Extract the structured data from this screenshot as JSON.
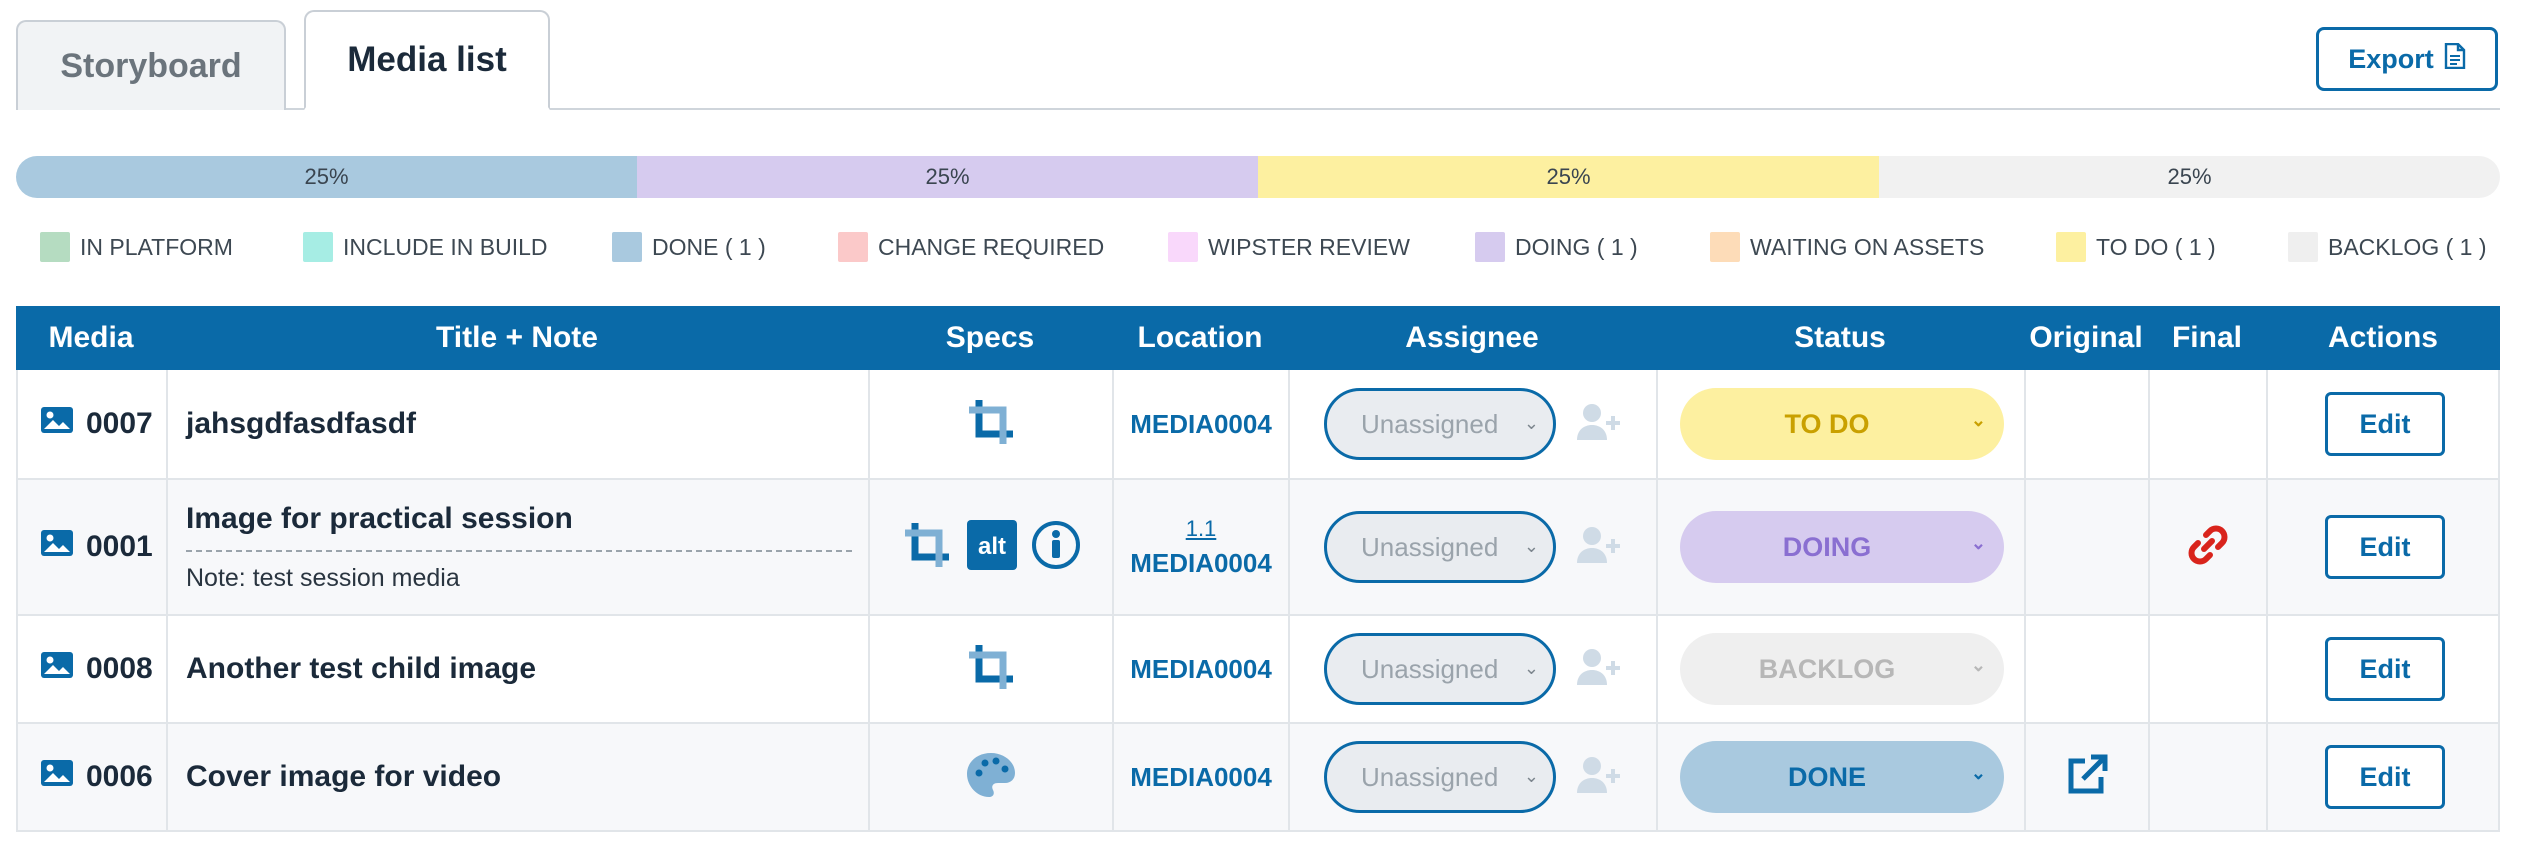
{
  "tabs": [
    {
      "label": "Storyboard",
      "active": false
    },
    {
      "label": "Media list",
      "active": true
    }
  ],
  "export": {
    "label": "Export",
    "icon": "document-icon"
  },
  "progress": {
    "segments": [
      {
        "label": "25%",
        "value": 25,
        "color": "#a9c9df"
      },
      {
        "label": "25%",
        "value": 25,
        "color": "#d6cbef"
      },
      {
        "label": "25%",
        "value": 25,
        "color": "#fdf0a0"
      },
      {
        "label": "25%",
        "value": 25,
        "color": "#f1f1f1"
      }
    ]
  },
  "legend": [
    {
      "label": "IN PLATFORM",
      "color": "#b5dcc1"
    },
    {
      "label": "INCLUDE IN BUILD",
      "color": "#a6ede4"
    },
    {
      "label": "DONE ( 1 )",
      "color": "#a9c9df"
    },
    {
      "label": "CHANGE REQUIRED",
      "color": "#fbc9c9"
    },
    {
      "label": "WIPSTER REVIEW",
      "color": "#f9d8fb"
    },
    {
      "label": "DOING ( 1 )",
      "color": "#d6cbef"
    },
    {
      "label": "WAITING ON ASSETS",
      "color": "#fddcb8"
    },
    {
      "label": "TO DO ( 1 )",
      "color": "#fdf0a0"
    },
    {
      "label": "BACKLOG ( 1 )",
      "color": "#efefef"
    }
  ],
  "table": {
    "headers": {
      "media": "Media",
      "title": "Title + Note",
      "specs": "Specs",
      "location": "Location",
      "assignee": "Assignee",
      "status": "Status",
      "original": "Original",
      "final": "Final",
      "actions": "Actions"
    },
    "rows": [
      {
        "id": "0007",
        "title": "jahsgdfasdfasdf",
        "note": "",
        "location": "MEDIA0004",
        "location_sub": "",
        "assignee": "Unassigned",
        "status": "TO DO",
        "status_bg": "#fdf0a0",
        "status_fg": "#c9a000",
        "edit": "Edit"
      },
      {
        "id": "0001",
        "title": "Image for practical session",
        "note": "Note: test session media",
        "location": "MEDIA0004",
        "location_sub": "1.1",
        "assignee": "Unassigned",
        "status": "DOING",
        "status_bg": "#d6cbef",
        "status_fg": "#8a6fd1",
        "edit": "Edit"
      },
      {
        "id": "0008",
        "title": "Another test child image",
        "note": "",
        "location": "MEDIA0004",
        "location_sub": "",
        "assignee": "Unassigned",
        "status": "BACKLOG",
        "status_bg": "#efefef",
        "status_fg": "#b7b7b7",
        "edit": "Edit"
      },
      {
        "id": "0006",
        "title": "Cover image for video",
        "note": "",
        "location": "MEDIA0004",
        "location_sub": "",
        "assignee": "Unassigned",
        "status": "DONE",
        "status_bg": "#a9c9df",
        "status_fg": "#0a6aa8",
        "edit": "Edit"
      }
    ]
  },
  "colors": {
    "brand": "#0a6aa8",
    "link_red": "#d9241c"
  }
}
